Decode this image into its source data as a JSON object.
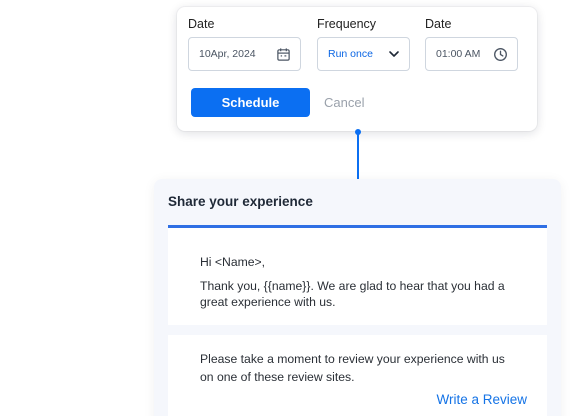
{
  "schedule": {
    "fields": [
      {
        "label": "Date",
        "value": "10Apr, 2024",
        "icon": "calendar-icon"
      },
      {
        "label": "Frequency",
        "value": "Run once",
        "icon": "chevron-down-icon"
      },
      {
        "label": "Date",
        "value": "01:00 AM",
        "icon": "clock-icon"
      }
    ],
    "schedule_label": "Schedule",
    "cancel_label": "Cancel"
  },
  "email": {
    "title": "Share your experience",
    "greeting": "Hi <Name>,",
    "thanks": "Thank you, {{name}}. We are glad to hear that you had a great experience with us.",
    "review_prompt": "Please take a moment to review your experience with us on one of these review sites.",
    "review_link": "Write a Review"
  },
  "colors": {
    "accent": "#0b6ff2",
    "link": "#1473e6",
    "panel_bg": "#f5f7fc"
  }
}
